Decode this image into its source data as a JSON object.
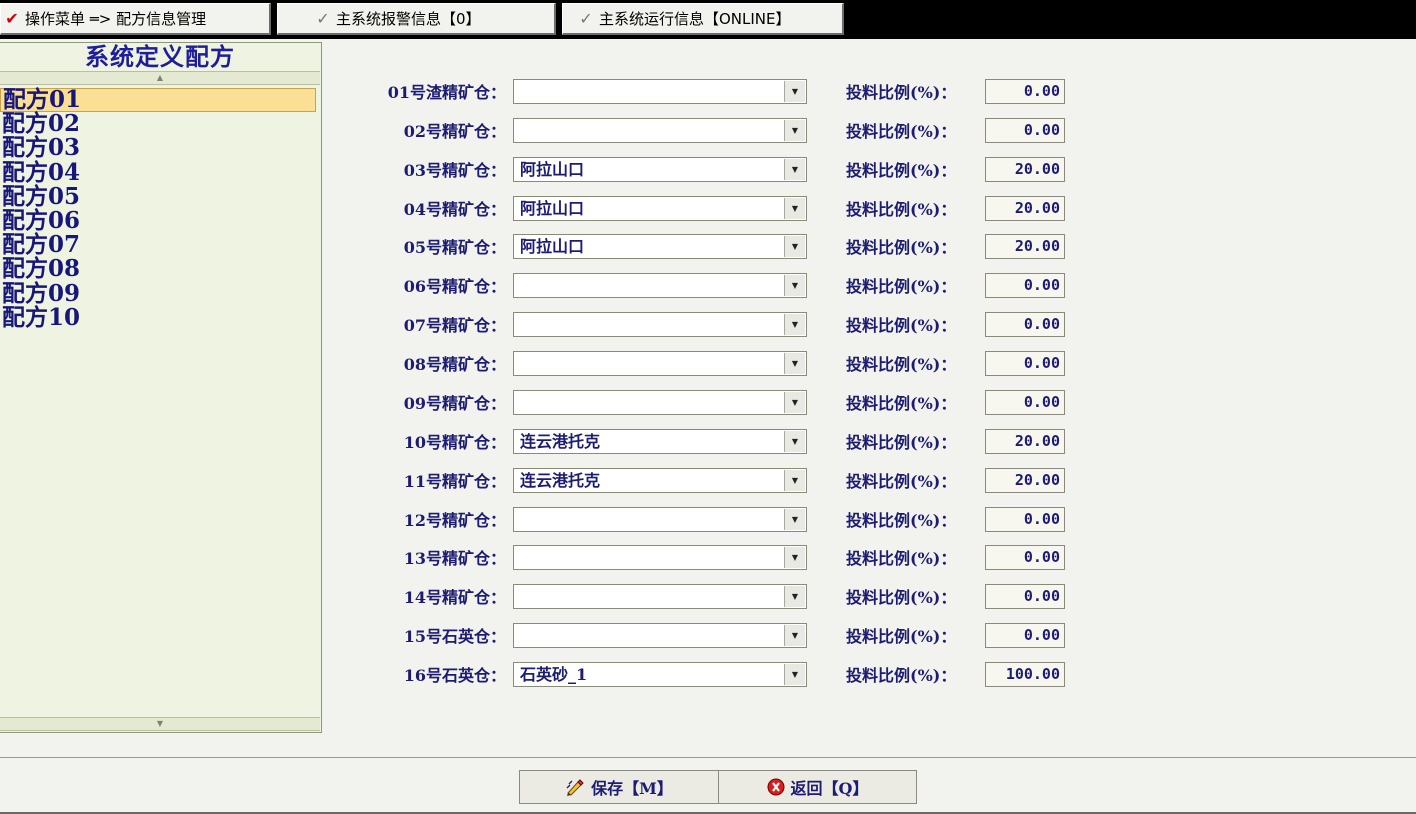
{
  "tabs": [
    {
      "icon": "checkmark-icon",
      "label": "操作菜单 ═> 配方信息管理",
      "active": true
    },
    {
      "icon": "checkmark-icon",
      "label": "主系统报警信息【0】",
      "active": false
    },
    {
      "icon": "checkmark-icon",
      "label": "主系统运行信息【ONLINE】",
      "active": false
    }
  ],
  "recipe_list": {
    "title": "系统定义配方",
    "selected": "配方01",
    "items": [
      "配方01",
      "配方02",
      "配方03",
      "配方04",
      "配方05",
      "配方06",
      "配方07",
      "配方08",
      "配方09",
      "配方10"
    ]
  },
  "form": {
    "ratio_label": "投料比例(%)：",
    "rows": [
      {
        "bin": "01号渣精矿仓：",
        "material": "",
        "ratio": "0.00"
      },
      {
        "bin": "02号精矿仓：",
        "material": "",
        "ratio": "0.00"
      },
      {
        "bin": "03号精矿仓：",
        "material": "阿拉山口",
        "ratio": "20.00"
      },
      {
        "bin": "04号精矿仓：",
        "material": "阿拉山口",
        "ratio": "20.00"
      },
      {
        "bin": "05号精矿仓：",
        "material": "阿拉山口",
        "ratio": "20.00"
      },
      {
        "bin": "06号精矿仓：",
        "material": "",
        "ratio": "0.00"
      },
      {
        "bin": "07号精矿仓：",
        "material": "",
        "ratio": "0.00"
      },
      {
        "bin": "08号精矿仓：",
        "material": "",
        "ratio": "0.00"
      },
      {
        "bin": "09号精矿仓：",
        "material": "",
        "ratio": "0.00"
      },
      {
        "bin": "10号精矿仓：",
        "material": "连云港托克",
        "ratio": "20.00"
      },
      {
        "bin": "11号精矿仓：",
        "material": "连云港托克",
        "ratio": "20.00"
      },
      {
        "bin": "12号精矿仓：",
        "material": "",
        "ratio": "0.00"
      },
      {
        "bin": "13号精矿仓：",
        "material": "",
        "ratio": "0.00"
      },
      {
        "bin": "14号精矿仓：",
        "material": "",
        "ratio": "0.00"
      },
      {
        "bin": "15号石英仓：",
        "material": "",
        "ratio": "0.00"
      },
      {
        "bin": "16号石英仓：",
        "material": "石英砂_1",
        "ratio": "100.00"
      }
    ]
  },
  "actions": {
    "save_label": "保存【M】",
    "back_label": "返回【Q】"
  },
  "colors": {
    "label_text": "#1c1c72",
    "recipe_text": "#17177a",
    "selected_bg": "#fbdf95",
    "panel_bg": "#eff3e1",
    "top_bar_bg": "#000000",
    "active_check": "#d10000"
  }
}
